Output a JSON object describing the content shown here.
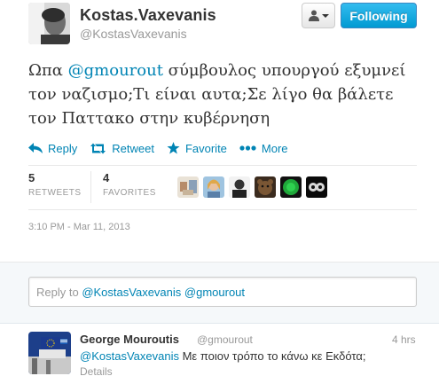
{
  "author": {
    "fullname": "Kostas.Vaxevanis",
    "screen_name": "@KostasVaxevanis",
    "follow_label": "Following"
  },
  "tweet": {
    "text_pre": "Ωπα ",
    "mention": "@gmourout",
    "text_post": " σύμβουλος υπουργού εξυμνεί τον ναζισμο;Τι είναι αυτα;Σε λίγο θα βάλετε τον Παττακο στην κυβέρνηση",
    "timestamp": "3:10 PM - Mar 11, 2013"
  },
  "actions": {
    "reply": "Reply",
    "retweet": "Retweet",
    "favorite": "Favorite",
    "more": "More"
  },
  "stats": {
    "retweets_count": "5",
    "retweets_label": "RETWEETS",
    "favorites_count": "4",
    "favorites_label": "FAVORITES"
  },
  "reply_box": {
    "prefix": "Reply to ",
    "mention1": "@KostasVaxevanis",
    "mention2": "@gmourout"
  },
  "reply_tweet": {
    "fullname": "George Mouroutis",
    "screen_name": "@gmourout",
    "time": "4 hrs",
    "mention": "@KostasVaxevanis",
    "text": " Με ποιον τρόπο το κάνω κε Εκδότα;",
    "details": "Details"
  },
  "colors": {
    "link": "#0084b4",
    "follow_button": "#019ad2"
  }
}
